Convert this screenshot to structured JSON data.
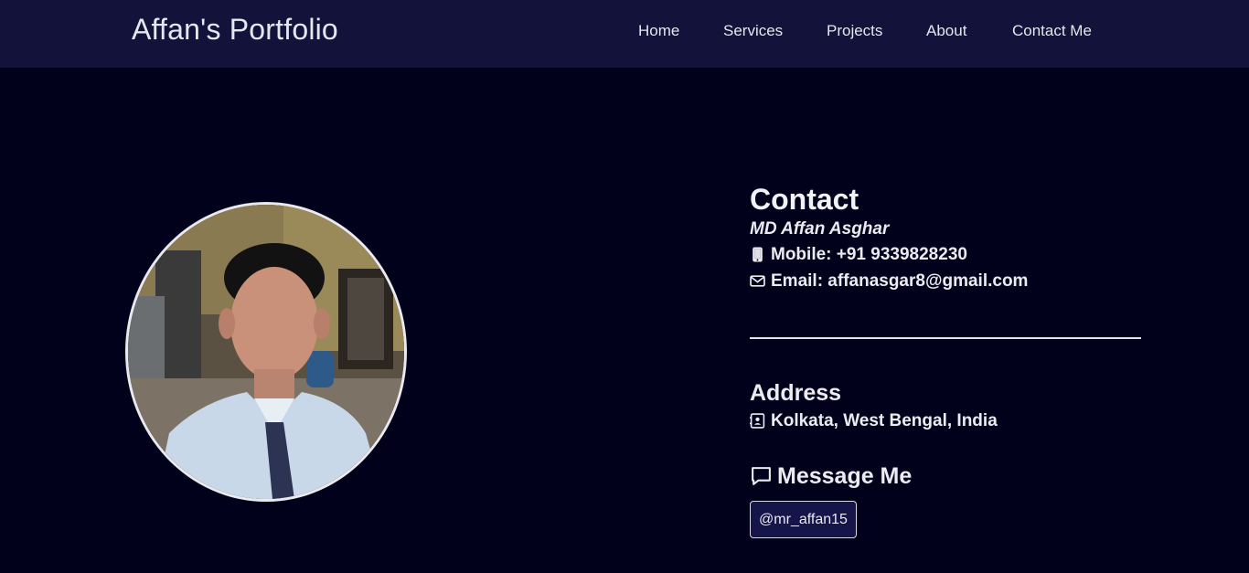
{
  "header": {
    "brand": "Affan's Portfolio",
    "nav": [
      "Home",
      "Services",
      "Projects",
      "About",
      "Contact Me"
    ]
  },
  "contact": {
    "heading": "Contact",
    "name": "MD Affan Asghar",
    "mobile": "Mobile: +91 9339828230",
    "email": "Email: affanasgar8@gmail.com"
  },
  "address": {
    "heading": "Address",
    "location": "Kolkata, West Bengal, India"
  },
  "message": {
    "heading": "Message Me",
    "handle": "@mr_affan15"
  },
  "icons": {
    "mobile": "mobile-icon",
    "email": "envelope-icon",
    "address": "address-book-icon",
    "message": "comment-icon"
  },
  "colors": {
    "background": "#01011c",
    "navbar": "#12123a",
    "button": "#15154a",
    "text": "#ecebf2"
  }
}
